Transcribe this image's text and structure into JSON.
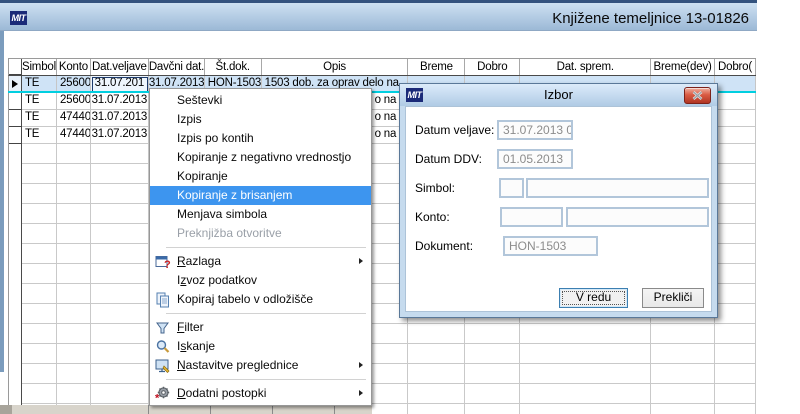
{
  "window": {
    "logo": "MIT",
    "title": "Knjižene temeljnice 13-01826"
  },
  "colors": {
    "menu_highlight": "#3d95ef",
    "selected_row_bg": "#cfe3f6",
    "selected_row_underline": "#00cfe0",
    "close_button_red": "#b03523",
    "titlebar_blue": "#9cb9d6"
  },
  "table": {
    "columns": [
      "",
      "Simbol",
      "Konto",
      "Dat.veljave",
      "Davčni dat.",
      "Št.dok.",
      "Opis",
      "Breme",
      "Dobro",
      "Dat. sprem.",
      "Breme(dev)",
      "Dobro("
    ],
    "rows": [
      {
        "simbol": "TE",
        "konto": "25600",
        "dat_veljave": "31.07.201",
        "davcni_dat": "31.07.2013",
        "st_dok": "HON-1503",
        "opis": "1503 dob. za oprav delo na",
        "selected": true
      },
      {
        "simbol": "TE",
        "konto": "25600",
        "dat_veljave": "31.07.2013",
        "davcni_dat": "",
        "st_dok": "",
        "opis": "o na",
        "selected": false
      },
      {
        "simbol": "TE",
        "konto": "47440",
        "dat_veljave": "31.07.2013",
        "davcni_dat": "",
        "st_dok": "",
        "opis": "o na",
        "selected": false
      },
      {
        "simbol": "TE",
        "konto": "47440",
        "dat_veljave": "31.07.2013",
        "davcni_dat": "",
        "st_dok": "",
        "opis": "o na",
        "selected": false
      }
    ]
  },
  "context_menu": {
    "items": [
      {
        "label": "Seštevki"
      },
      {
        "label": "Izpis"
      },
      {
        "label": "Izpis po kontih"
      },
      {
        "label": "Kopiranje z negativno vrednostjo"
      },
      {
        "label": "Kopiranje"
      },
      {
        "label": "Kopiranje z brisanjem",
        "state": "highlighted"
      },
      {
        "label": "Menjava simbola"
      },
      {
        "label": "Preknjižba otvoritve",
        "state": "disabled"
      },
      {
        "label": "Razlaga",
        "icon": "help-icon",
        "submenu": true
      },
      {
        "label": "Izvoz podatkov"
      },
      {
        "label": "Kopiraj tabelo v odložišče",
        "icon": "copy-icon"
      },
      {
        "label": "Filter",
        "icon": "filter-icon"
      },
      {
        "label": "Iskanje",
        "icon": "search-icon"
      },
      {
        "label": "Nastavitve preglednice",
        "icon": "grid-settings-icon",
        "submenu": true
      },
      {
        "label": "Dodatni postopki",
        "icon": "gear-icon",
        "submenu": true
      }
    ]
  },
  "dialog": {
    "logo": "MIT",
    "title": "Izbor",
    "fields": [
      {
        "label": "Datum veljave:",
        "value": "31.07.2013 0"
      },
      {
        "label": "Datum DDV:",
        "value": "01.05.2013"
      },
      {
        "label": "Simbol:",
        "value": "",
        "value2": ""
      },
      {
        "label": "Konto:",
        "value": "",
        "value2": ""
      },
      {
        "label": "Dokument:",
        "value": "HON-1503"
      }
    ],
    "buttons": {
      "ok": "V redu",
      "cancel": "Prekliči"
    }
  }
}
